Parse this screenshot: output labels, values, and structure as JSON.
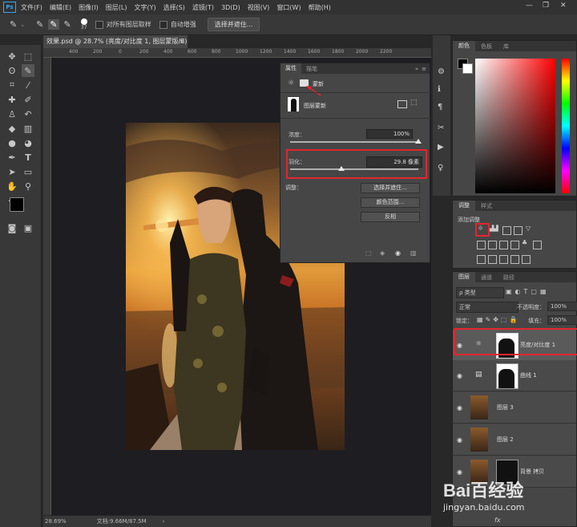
{
  "menubar": {
    "logo": "Ps",
    "items": [
      "文件(F)",
      "编辑(E)",
      "图像(I)",
      "图层(L)",
      "文字(Y)",
      "选择(S)",
      "滤镜(T)",
      "3D(D)",
      "视图(V)",
      "窗口(W)",
      "帮助(H)"
    ],
    "minimize": "—",
    "restore": "❐",
    "close": "✕"
  },
  "options": {
    "brush_size": "37",
    "sample_all_layers": "对所有图层取样",
    "auto_enhance": "自动增强",
    "select_and_mask": "选择并遮住..."
  },
  "document": {
    "tab_title": "效果.psd @ 28.7% (亮度/对比度 1, 图层蒙版/8) *",
    "tab_close": "×",
    "ruler_ticks": [
      "400",
      "200",
      "0",
      "200",
      "400",
      "600",
      "800",
      "1000",
      "1200",
      "1400",
      "1600",
      "1800",
      "2000",
      "2200"
    ],
    "zoom": "28.69%",
    "doc_info": "文档:9.66M/87.5M"
  },
  "properties": {
    "tabs": [
      "属性",
      "描笔"
    ],
    "collapse": "»",
    "menu": "≡",
    "mask_type": "蒙新",
    "mask_label": "图层蒙新",
    "density_label": "浓度：",
    "density_value": "100%",
    "density_level": 1.0,
    "feather_label": "羽化：",
    "feather_value": "29.8 像素",
    "feather_level": 0.4,
    "refine_label": "调整：",
    "btn_select_mask": "选择并遮住...",
    "btn_color_range": "颜色范围...",
    "btn_invert": "反相"
  },
  "color_panel": {
    "tabs": [
      "颜色",
      "色板",
      "库"
    ],
    "fg": "#000000",
    "bg": "#ffffff"
  },
  "adjustments_panel": {
    "tabs": [
      "调整",
      "样式"
    ],
    "add_label": "添加调整"
  },
  "layers_panel": {
    "tabs": [
      "图层",
      "通道",
      "路径"
    ],
    "filter_kind": "ρ 类型",
    "blend_mode": "正常",
    "opacity_label": "不透明度：",
    "opacity_value": "100%",
    "lock_label": "锁定：",
    "fill_label": "填充：",
    "fill_value": "100%",
    "layers": [
      {
        "name": "亮度/对比度 1",
        "type": "adjustment",
        "selected": true
      },
      {
        "name": "曲线 1",
        "type": "adjustment",
        "selected": false
      },
      {
        "name": "图层 3",
        "type": "pixel",
        "selected": false
      },
      {
        "name": "图层 2",
        "type": "pixel",
        "selected": false
      },
      {
        "name": "背景 拷贝",
        "type": "pixel",
        "selected": false
      }
    ],
    "footer": "fx"
  },
  "watermark": {
    "brand": "Bai百经验",
    "url": "jingyan.baidu.com"
  }
}
